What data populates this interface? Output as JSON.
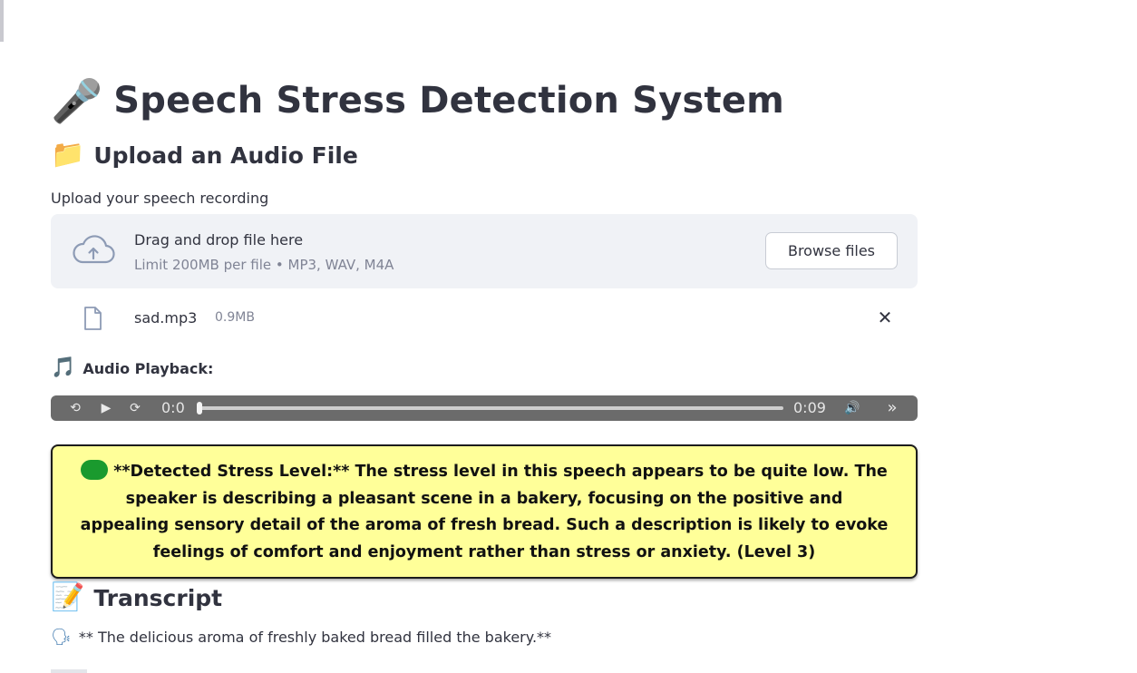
{
  "title": {
    "icon": "microphone-emoji",
    "icon_glyph": "🎤",
    "text": "Speech Stress Detection System"
  },
  "upload_section": {
    "icon": "folder-emoji",
    "icon_glyph": "📁",
    "heading": "Upload an Audio File",
    "label": "Upload your speech recording",
    "dropzone": {
      "icon": "cloud-upload-icon",
      "main_text": "Drag and drop file here",
      "limit_text": "Limit 200MB per file • MP3, WAV, M4A",
      "browse_label": "Browse files"
    },
    "file": {
      "icon": "file-icon",
      "name": "sad.mp3",
      "size": "0.9MB",
      "remove_glyph": "✕"
    }
  },
  "playback": {
    "icon_glyph": "🎵",
    "label": "Audio Playback:",
    "player": {
      "rewind_glyph": "⟲",
      "play_glyph": "▶",
      "forward_glyph": "⟳",
      "current_time": "0:0",
      "duration": "0:09",
      "volume_glyph": "🔊",
      "more_glyph": "»",
      "progress_fraction": 0.0
    }
  },
  "result": {
    "status_color": "#1a9a2e",
    "background_color": "#ffff99",
    "text": "**Detected Stress Level:** The stress level in this speech appears to be quite low. The speaker is describing a pleasant scene in a bakery, focusing on the positive and appealing sensory detail of the aroma of fresh bread. Such a description is likely to evoke feelings of comfort and enjoyment rather than stress or anxiety. (Level 3)"
  },
  "transcript": {
    "icon_glyph": "📝",
    "heading": "Transcript",
    "line_icon_glyph": "🗣",
    "text": "** The delicious aroma of freshly baked bread filled the bakery.**"
  }
}
